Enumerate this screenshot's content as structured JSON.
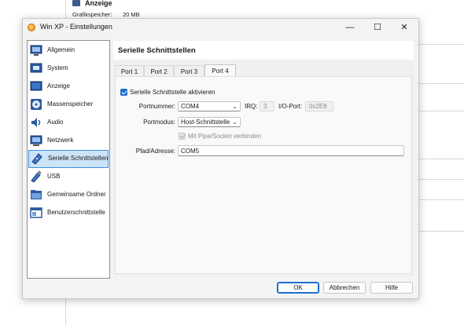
{
  "background": {
    "header_title": "Anzeige",
    "header_label": "Grafikspeicher:",
    "header_value": "20 MB"
  },
  "window": {
    "title": "Win XP - Einstellungen",
    "minimize_glyph": "—",
    "maximize_glyph": "☐",
    "close_glyph": "✕"
  },
  "nav": {
    "items": [
      {
        "label": "Allgemein",
        "icon": "monitor-icon"
      },
      {
        "label": "System",
        "icon": "chip-icon"
      },
      {
        "label": "Anzeige",
        "icon": "display-icon"
      },
      {
        "label": "Massenspeicher",
        "icon": "disk-icon"
      },
      {
        "label": "Audio",
        "icon": "speaker-icon"
      },
      {
        "label": "Netzwerk",
        "icon": "network-icon"
      },
      {
        "label": "Serielle Schnittstellen",
        "icon": "serial-port-icon",
        "selected": true
      },
      {
        "label": "USB",
        "icon": "usb-icon"
      },
      {
        "label": "Gemeinsame Ordner",
        "icon": "folder-icon"
      },
      {
        "label": "Benutzerschnittstelle",
        "icon": "ui-window-icon"
      }
    ]
  },
  "page": {
    "title": "Serielle Schnittstellen",
    "tabs": [
      "Port 1",
      "Port 2",
      "Port 3",
      "Port 4"
    ],
    "active_tab": "Port 4",
    "enable_label": "Serielle Schnittstelle aktivieren",
    "portnumber_label": "Portnummer:",
    "portnumber_value": "COM4",
    "irq_label": "IRQ:",
    "irq_value": "3",
    "io_label": "I/O-Port:",
    "io_value": "0x2E8",
    "portmode_label": "Portmodus:",
    "portmode_value": "Host-Schnittstelle",
    "pipe_label": "Mit Pipe/Socket verbinden",
    "path_label": "Pfad/Adresse:",
    "path_value": "COM5"
  },
  "buttons": {
    "ok": "OK",
    "cancel": "Abbrechen",
    "help": "Hilfe"
  },
  "colors": {
    "accent": "#1e6fd0",
    "selection_bg": "#cce4f7"
  }
}
